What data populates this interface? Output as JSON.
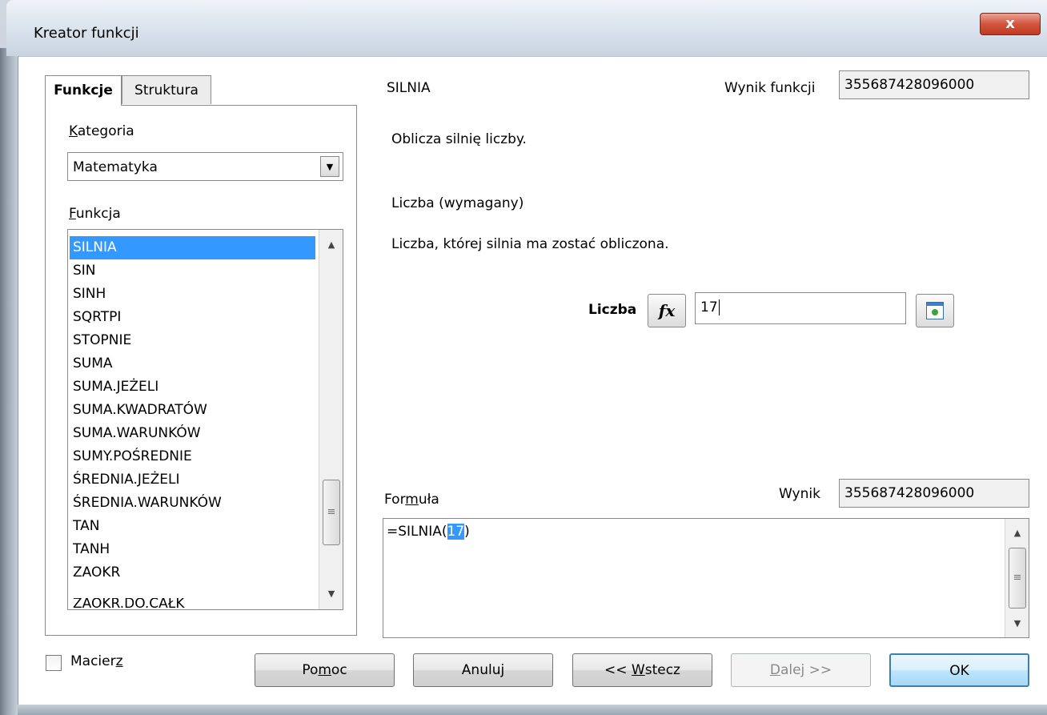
{
  "window": {
    "title": "Kreator funkcji",
    "close_glyph": "x"
  },
  "tabs": [
    {
      "label": "Funkcje",
      "active": true
    },
    {
      "label": "Struktura",
      "active": false
    }
  ],
  "category": {
    "label": "Kategoria",
    "label_underline": "K",
    "label_rest": "ategoria",
    "value": "Matematyka"
  },
  "functions": {
    "label_underline": "F",
    "label_rest": "unkcja",
    "items": [
      "SILNIA",
      "SIN",
      "SINH",
      "SQRTPI",
      "STOPNIE",
      "SUMA",
      "SUMA.JEŻELI",
      "SUMA.KWADRATÓW",
      "SUMA.WARUNKÓW",
      "SUMY.POŚREDNIE",
      "ŚREDNIA.JEŻELI",
      "ŚREDNIA.WARUNKÓW",
      "TAN",
      "TANH",
      "ZAOKR",
      "ZAOKR.DO.CAŁK"
    ],
    "selected": "SILNIA"
  },
  "function_info": {
    "name": "SILNIA",
    "result_label": "Wynik funkcji",
    "result_value": "355687428096000",
    "description": "Oblicza silnię liczby.",
    "param_title": "Liczba (wymagany)",
    "param_description": "Liczba, której silnia ma zostać obliczona."
  },
  "argument": {
    "label": "Liczba",
    "fx_icon": "fx",
    "value": "17"
  },
  "formula": {
    "label_pre": "For",
    "label_underline": "m",
    "label_post": "uła",
    "result_label": "Wynik",
    "result_value": "355687428096000",
    "text_pre": "=SILNIA(",
    "text_selected": "17",
    "text_post": ")"
  },
  "array_checkbox": {
    "label_pre": "Macier",
    "label_underline": "z",
    "checked": false
  },
  "buttons": {
    "help_pre": "Po",
    "help_underline": "m",
    "help_post": "oc",
    "cancel": "Anuluj",
    "back_pre": "<< ",
    "back_underline": "W",
    "back_post": "stecz",
    "next_underline": "D",
    "next_post": "alej >>",
    "ok": "OK"
  }
}
